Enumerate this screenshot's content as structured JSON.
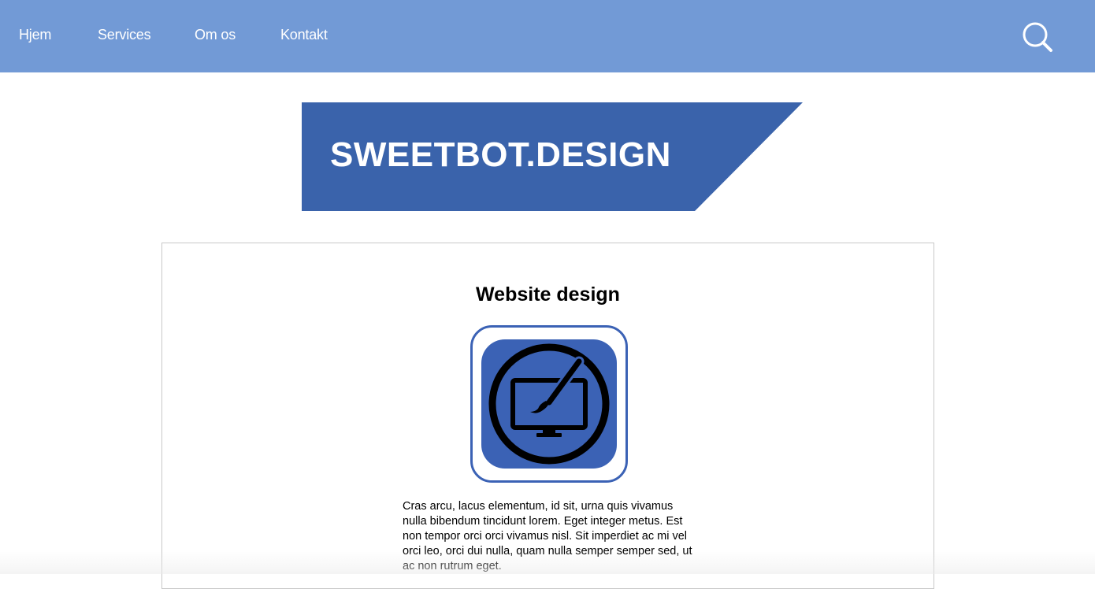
{
  "nav": {
    "items": [
      {
        "label": "Hjem"
      },
      {
        "label": "Services"
      },
      {
        "label": "Om os"
      },
      {
        "label": "Kontakt"
      }
    ],
    "search_icon": "search-icon"
  },
  "logo": {
    "text": "SWEETBOT.DESIGN",
    "color": "#3a63ab"
  },
  "card": {
    "title": "Website design",
    "icon": "monitor-paintbrush-icon",
    "body": "Cras arcu, lacus elementum, id sit, urna quis vivamus nulla bibendum tincidunt lorem. Eget integer metus. Est non tempor orci orci vivamus nisl. Sit imperdiet ac mi vel orci leo, orci dui nulla, quam nulla semper semper sed, ut ac non rutrum eget."
  },
  "colors": {
    "nav_bg": "#729ad6",
    "brand": "#3a63ab",
    "icon_bg": "#3b62b5"
  }
}
